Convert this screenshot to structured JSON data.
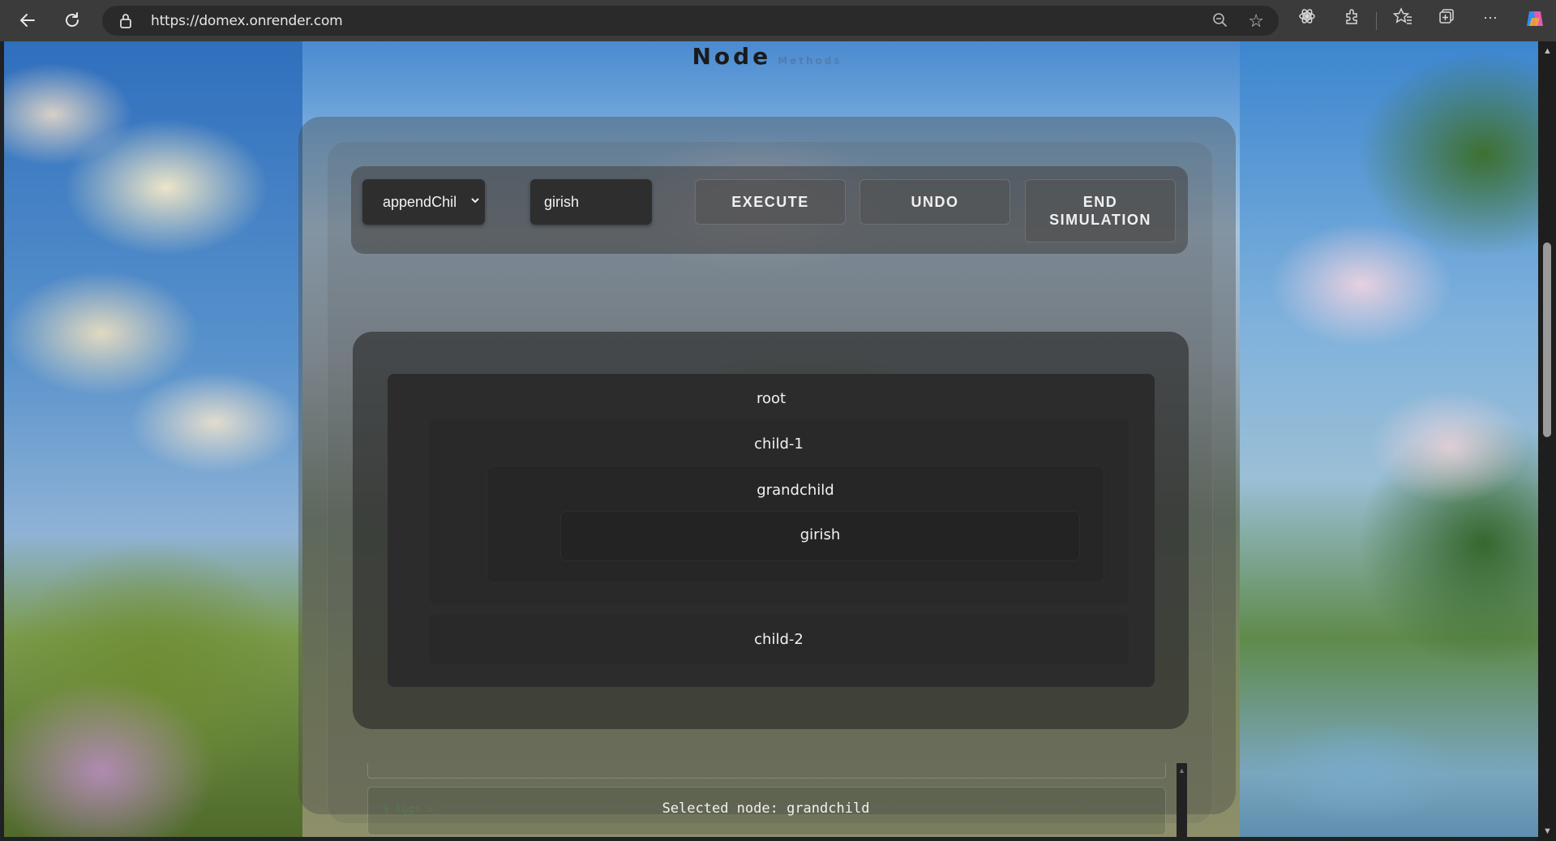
{
  "browser": {
    "url": "https://domex.onrender.com"
  },
  "page": {
    "title": "Node",
    "subtitle": "Methods"
  },
  "controls": {
    "method_selected": "appendChil",
    "value_input": "girish",
    "execute_label": "EXECUTE",
    "undo_label": "UNDO",
    "end_label_line1": "END",
    "end_label_line2": "SIMULATION"
  },
  "tree": {
    "root": "root",
    "child1": "child-1",
    "grandchild": "grandchild",
    "girish": "girish",
    "child2": "child-2"
  },
  "console": {
    "faint_label": "$ logs >_",
    "message": "Selected node: grandchild"
  }
}
